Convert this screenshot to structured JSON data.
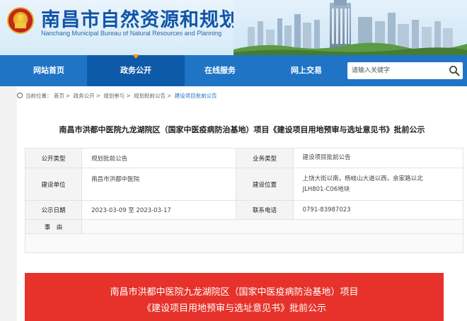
{
  "header": {
    "title": "南昌市自然资源和规划局",
    "subtitle": "Nanchang Municipal Bureau of Natural Resources and Planning"
  },
  "nav": {
    "items": [
      {
        "label": "网站首页",
        "active": false
      },
      {
        "label": "政务公开",
        "active": true
      },
      {
        "label": "在线服务",
        "active": false
      },
      {
        "label": "网上交易",
        "active": false
      }
    ],
    "search_placeholder": "请输入关键字"
  },
  "breadcrumb": {
    "prefix": "当前位置：",
    "items": [
      "首页",
      "政务公开",
      "规划参与",
      "规划批前公告",
      "建设项目批前公告"
    ]
  },
  "document": {
    "title": "南昌市洪都中医院九龙湖院区（国家中医疫病防治基地）项目《建设项目用地预审与选址意见书》批前公示",
    "fields": {
      "type_label": "公开类型",
      "type_value": "规划批前公告",
      "business_label": "业务类型",
      "business_value": "建设项目批前公告",
      "unit_label": "建设单位",
      "unit_value": "南昌市洪都中医院",
      "location_label": "建设位置",
      "location_value_1": "上饶大街以南，杨岐山大道以西，余家路以北",
      "location_value_2": "JLH801-C06地块",
      "date_label": "公示日期",
      "date_value": "2023-03-09 至 2023-03-17",
      "contact_label": "联系电话",
      "contact_value": "0791-83987023",
      "reason_label": "事　由"
    }
  },
  "banner": {
    "line1": "南昌市洪都中医院九龙湖院区（国家中医疫病防治基地）项目",
    "line2": "《建设项目用地预审与选址意见书》批前公示"
  },
  "colors": {
    "nav_bg": "#1f74c6",
    "nav_active": "#0d5aa8",
    "title_blue": "#1155a8",
    "banner_red": "#e6322a",
    "caret_orange": "#ff9900"
  }
}
